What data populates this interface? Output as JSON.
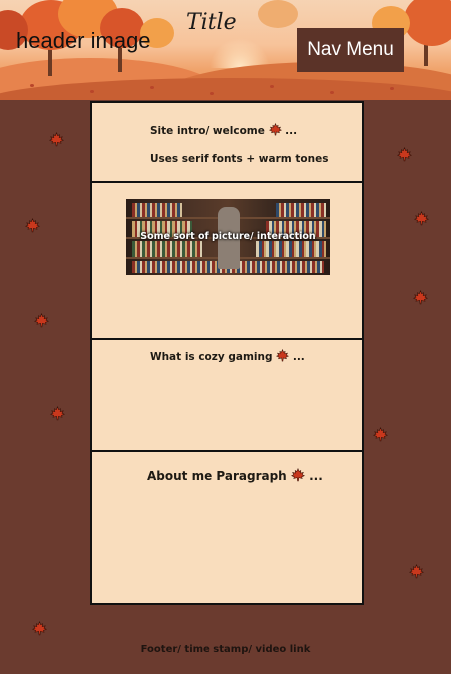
{
  "header": {
    "image_label": "header image",
    "title": "Title",
    "nav_label": "Nav Menu"
  },
  "sections": {
    "intro_line1": "Site intro/ welcome",
    "intro_line1_suffix": "...",
    "intro_line2": "Uses serif fonts + warm tones",
    "picture_caption": "Some sort of picture/ interaction",
    "cozy": "What is cozy gaming",
    "cozy_suffix": "...",
    "about": "About me Paragraph",
    "about_suffix": "..."
  },
  "footer": {
    "text": "Footer/ time stamp/ video link"
  },
  "colors": {
    "background": "#6b3b2f",
    "panel": "#f9ddbd",
    "nav_button": "#5b3328",
    "leaf": "#c9381d"
  },
  "icons": [
    "maple-leaf-icon"
  ]
}
